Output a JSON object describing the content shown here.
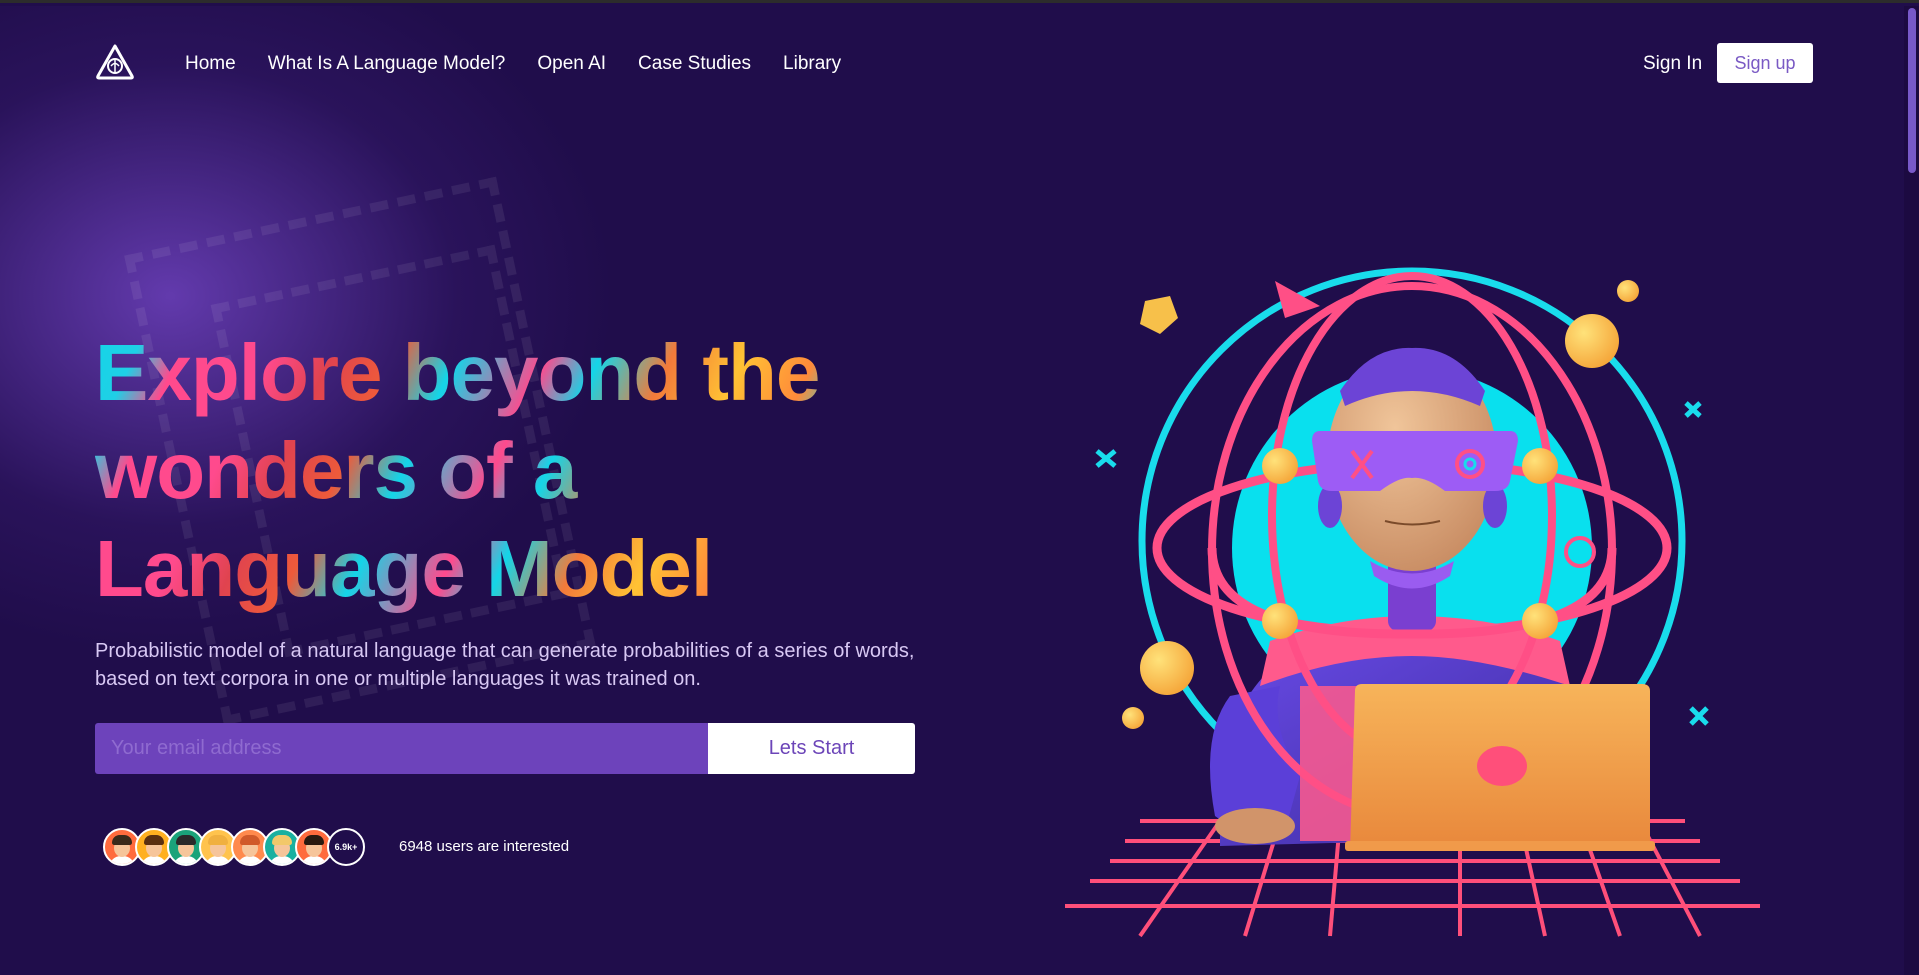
{
  "nav": {
    "links": [
      "Home",
      "What Is A Language Model?",
      "Open AI",
      "Case Studies",
      "Library"
    ],
    "sign_in": "Sign In",
    "sign_up": "Sign up"
  },
  "hero": {
    "title_line1": "Explore beyond the",
    "title_line2": "wonders of a",
    "title_line3": "Language Model",
    "subtitle": "Probabilistic model of a natural language that can generate probabilities of a series of words, based on text corpora in one or multiple languages it was trained on.",
    "email_placeholder": "Your email address",
    "cta": "Lets Start"
  },
  "social_proof": {
    "count_badge": "6.9k+",
    "text": "6948 users are interested",
    "avatar_colors": [
      "#ff6b3d",
      "#ffb020",
      "#1aa37a",
      "#ffc34d",
      "#ff8a4d",
      "#1ab0a0",
      "#ff6b3d"
    ]
  },
  "colors": {
    "background": "#200d4b",
    "accent_purple": "#6d43bb",
    "accent_cyan": "#14d5e8",
    "accent_pink": "#ff4a8d",
    "accent_yellow": "#ffc234"
  },
  "icons": {
    "logo": "brain-triangle-logo"
  }
}
